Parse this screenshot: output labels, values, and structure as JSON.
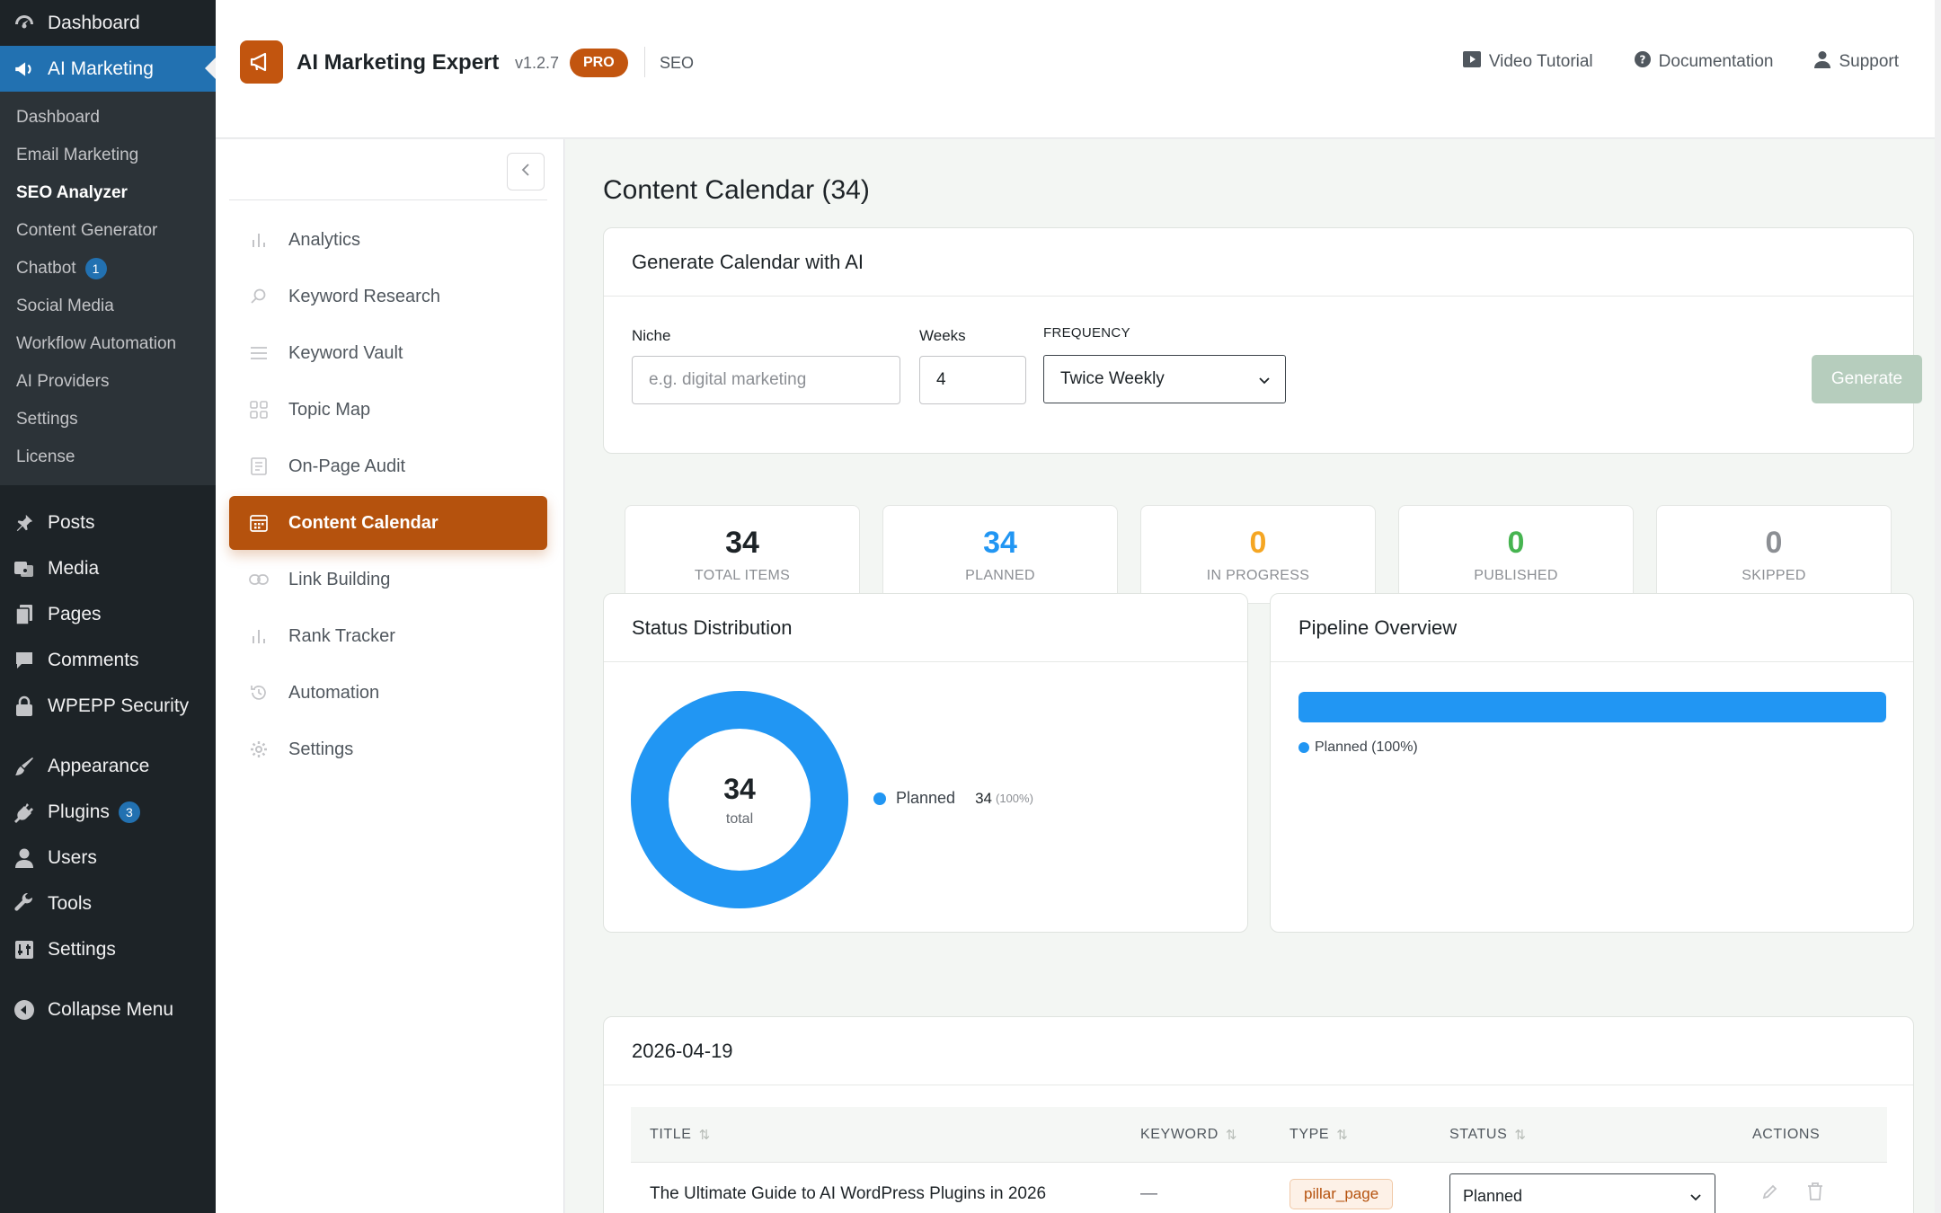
{
  "wp_sidebar": {
    "top_items": [
      {
        "label": "Dashboard",
        "icon": "dashboard-icon"
      },
      {
        "label": "AI Marketing",
        "icon": "megaphone-icon"
      }
    ],
    "submenu": [
      {
        "label": "Dashboard"
      },
      {
        "label": "Email Marketing"
      },
      {
        "label": "SEO Analyzer"
      },
      {
        "label": "Content Generator"
      },
      {
        "label": "Chatbot",
        "badge": "1"
      },
      {
        "label": "Social Media"
      },
      {
        "label": "Workflow Automation"
      },
      {
        "label": "AI Providers"
      },
      {
        "label": "Settings"
      },
      {
        "label": "License"
      }
    ],
    "menu": [
      {
        "label": "Posts",
        "icon": "pin-icon"
      },
      {
        "label": "Media",
        "icon": "media-icon"
      },
      {
        "label": "Pages",
        "icon": "pages-icon"
      },
      {
        "label": "Comments",
        "icon": "comment-icon"
      },
      {
        "label": "WPEPP Security",
        "icon": "lock-icon"
      },
      {
        "label": "Appearance",
        "icon": "brush-icon"
      },
      {
        "label": "Plugins",
        "icon": "plug-icon",
        "badge": "3"
      },
      {
        "label": "Users",
        "icon": "user-icon"
      },
      {
        "label": "Tools",
        "icon": "wrench-icon"
      },
      {
        "label": "Settings",
        "icon": "settings-icon"
      }
    ],
    "collapse": "Collapse Menu"
  },
  "header": {
    "title": "AI Marketing Expert",
    "version": "v1.2.7",
    "pro": "PRO",
    "section": "SEO",
    "links": [
      {
        "label": "Video Tutorial",
        "icon": "video-icon"
      },
      {
        "label": "Documentation",
        "icon": "help-icon"
      },
      {
        "label": "Support",
        "icon": "user-icon"
      }
    ]
  },
  "nav": [
    {
      "label": "Analytics",
      "icon": "bar-chart-icon"
    },
    {
      "label": "Keyword Research",
      "icon": "search-icon"
    },
    {
      "label": "Keyword Vault",
      "icon": "list-icon"
    },
    {
      "label": "Topic Map",
      "icon": "grid-icon"
    },
    {
      "label": "On-Page Audit",
      "icon": "document-icon"
    },
    {
      "label": "Content Calendar",
      "icon": "calendar-icon"
    },
    {
      "label": "Link Building",
      "icon": "link-icon"
    },
    {
      "label": "Rank Tracker",
      "icon": "bar-chart-icon"
    },
    {
      "label": "Automation",
      "icon": "history-icon"
    },
    {
      "label": "Settings",
      "icon": "gear-icon"
    }
  ],
  "page": {
    "title": "Content Calendar (34)",
    "generate": {
      "heading": "Generate Calendar with AI",
      "niche_label": "Niche",
      "niche_placeholder": "e.g. digital marketing",
      "weeks_label": "Weeks",
      "weeks_value": "4",
      "frequency_label": "FREQUENCY",
      "frequency_value": "Twice Weekly",
      "button": "Generate"
    },
    "stats": [
      {
        "value": "34",
        "label": "TOTAL ITEMS",
        "color": "#1d2327"
      },
      {
        "value": "34",
        "label": "PLANNED",
        "color": "#2196f3"
      },
      {
        "value": "0",
        "label": "IN PROGRESS",
        "color": "#f5a623"
      },
      {
        "value": "0",
        "label": "PUBLISHED",
        "color": "#46b450"
      },
      {
        "value": "0",
        "label": "SKIPPED",
        "color": "#8c8f94"
      }
    ],
    "status_distribution": {
      "heading": "Status Distribution",
      "center_value": "34",
      "center_label": "total",
      "legend_label": "Planned",
      "legend_value": "34",
      "legend_pct": "(100%)"
    },
    "pipeline": {
      "heading": "Pipeline Overview",
      "legend": "Planned (100%)",
      "planned_fraction": 1.0
    },
    "date_group": {
      "date": "2026-04-19",
      "columns": {
        "title": "TITLE",
        "keyword": "KEYWORD",
        "type": "TYPE",
        "status": "STATUS",
        "actions": "ACTIONS"
      },
      "rows": [
        {
          "title": "The Ultimate Guide to AI WordPress Plugins in 2026",
          "keyword": "—",
          "type": "pillar_page",
          "status": "Planned"
        }
      ]
    },
    "colors": {
      "accent": "#b5520d",
      "planned": "#2196f3"
    }
  },
  "chart_data": {
    "type": "pie",
    "categories": [
      "Planned"
    ],
    "values": [
      34
    ]
  }
}
